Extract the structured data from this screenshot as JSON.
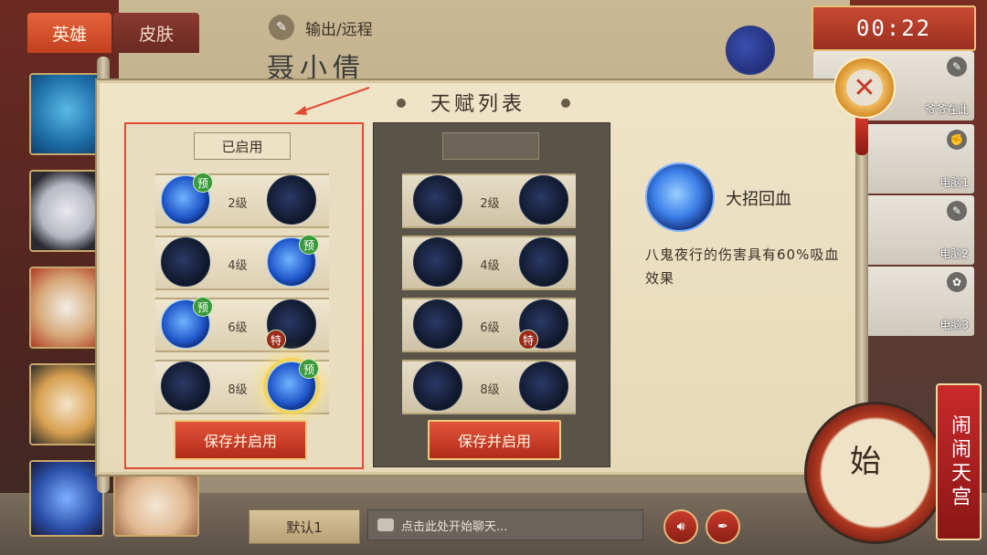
{
  "tabs": {
    "hero": "英雄",
    "skin": "皮肤"
  },
  "hero": {
    "role_icon": "knife-icon",
    "role_text": "输出/远程",
    "name": "聂小倩"
  },
  "timer": "00:22",
  "players": [
    {
      "name": "爷爷在此",
      "role_icon": "knife-icon"
    },
    {
      "name": "电脑1",
      "role_icon": "fist-icon"
    },
    {
      "name": "电脑2",
      "role_icon": "knife-icon"
    },
    {
      "name": "电脑3",
      "role_icon": "rabbit-icon"
    }
  ],
  "panel": {
    "title": "天赋列表",
    "enabled_label": "已启用",
    "rows": [
      {
        "level": "2级"
      },
      {
        "level": "4级"
      },
      {
        "level": "6级"
      },
      {
        "level": "8级"
      }
    ],
    "badge_text": "预",
    "special_badge": "特",
    "save_button": "保存并启用"
  },
  "detail": {
    "name": "大招回血",
    "description": "八鬼夜行的伤害具有60%吸血效果"
  },
  "bottom": {
    "preset": "默认1",
    "chat_placeholder": "点击此处开始聊天...",
    "start_text": "始",
    "logo_text": "闹闹天宫"
  },
  "colors": {
    "accent_red": "#c2401f",
    "highlight_border": "#e14a33",
    "gold": "#f4d35a"
  }
}
